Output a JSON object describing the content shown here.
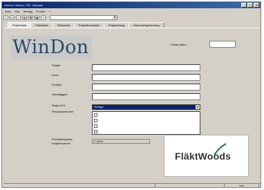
{
  "window": {
    "title": "WinDon Version 7.55 - Noname",
    "controls": [
      "_",
      "□",
      "✕"
    ]
  },
  "menu": [
    "Arkiv",
    "Visa",
    "Verktyg",
    "Fönster",
    "?"
  ],
  "toolbar": {
    "icons": [
      "new-icon",
      "open-icon",
      "save-icon",
      "print-icon",
      "copy-icon",
      "paste-icon",
      "help-icon"
    ],
    "combo_value": ""
  },
  "tabs": [
    "Projektdata",
    "Filtertabell",
    "Flödesbild",
    "Projektkostnader",
    "Projektritning",
    "Dokumentgenerering"
  ],
  "logo_text": "WinDon",
  "frame": {
    "label": "Första raden",
    "value": ""
  },
  "fields": [
    {
      "label": "Projekt",
      "value": ""
    },
    {
      "label": "Kund",
      "value": ""
    },
    {
      "label": "Kontakt",
      "value": ""
    },
    {
      "label": "Handläggare",
      "value": ""
    },
    {
      "label": "Region/Ort",
      "value": "Sverige"
    },
    {
      "label": "Produktionsenhet",
      "value": ""
    }
  ],
  "readonly": {
    "label1": "Produktionsplats",
    "label2": "Projektnummer",
    "value": "F-1009"
  },
  "brand": {
    "text": "FläktWoods",
    "color": "#1a7a3a"
  },
  "status": [
    "",
    "",
    "NUM"
  ]
}
